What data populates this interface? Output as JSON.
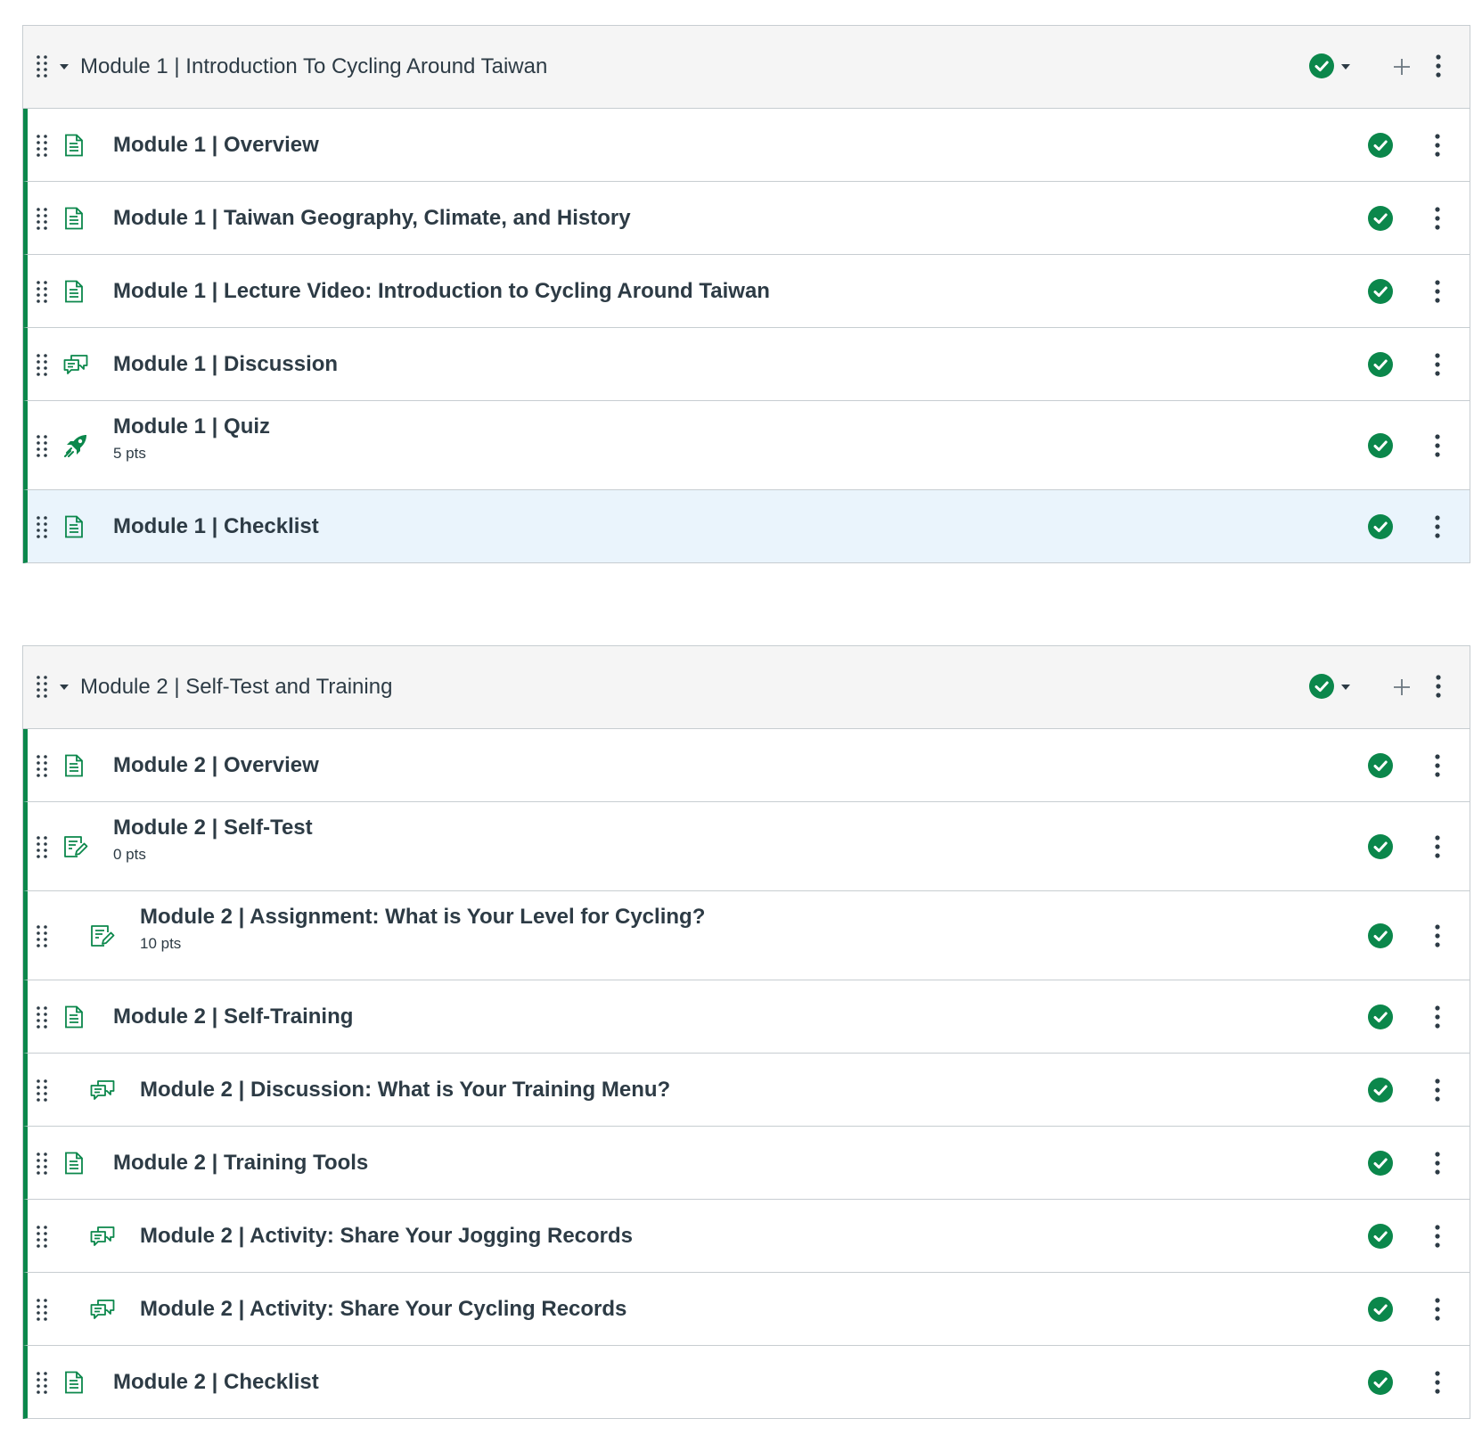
{
  "colors": {
    "accent_green": "#0b874b",
    "header_bg": "#f5f5f5",
    "text": "#2d3b45",
    "border": "#c7cdd1",
    "highlight_bg": "#eaf4fc"
  },
  "modules": [
    {
      "title": "Module 1 | Introduction To Cycling Around Taiwan",
      "published": true,
      "items": [
        {
          "title": "Module 1 | Overview",
          "icon": "page-icon",
          "indent": 0,
          "points": "",
          "published": true
        },
        {
          "title": "Module 1 | Taiwan Geography, Climate, and History",
          "icon": "page-icon",
          "indent": 0,
          "points": "",
          "published": true
        },
        {
          "title": "Module 1 | Lecture Video: Introduction to Cycling Around Taiwan",
          "icon": "page-icon",
          "indent": 0,
          "points": "",
          "published": true
        },
        {
          "title": "Module 1 | Discussion",
          "icon": "discussion-icon",
          "indent": 0,
          "points": "",
          "published": true
        },
        {
          "title": "Module 1 | Quiz",
          "icon": "quiz-rocket-icon",
          "indent": 0,
          "points": "5 pts",
          "published": true
        },
        {
          "title": "Module 1 | Checklist",
          "icon": "page-icon",
          "indent": 0,
          "points": "",
          "published": true,
          "highlighted": true
        }
      ]
    },
    {
      "title": "Module 2 | Self-Test and Training",
      "published": true,
      "items": [
        {
          "title": "Module 2 | Overview",
          "icon": "page-icon",
          "indent": 0,
          "points": "",
          "published": true
        },
        {
          "title": "Module 2 | Self-Test",
          "icon": "assignment-icon",
          "indent": 0,
          "points": "0 pts",
          "published": true
        },
        {
          "title": "Module 2 | Assignment: What is Your Level for Cycling?",
          "icon": "assignment-icon",
          "indent": 1,
          "points": "10 pts",
          "published": true
        },
        {
          "title": "Module 2 | Self-Training",
          "icon": "page-icon",
          "indent": 0,
          "points": "",
          "published": true
        },
        {
          "title": "Module 2 | Discussion: What is Your Training Menu?",
          "icon": "discussion-icon",
          "indent": 1,
          "points": "",
          "published": true
        },
        {
          "title": "Module 2 | Training Tools",
          "icon": "page-icon",
          "indent": 0,
          "points": "",
          "published": true
        },
        {
          "title": "Module 2 | Activity: Share Your Jogging Records",
          "icon": "discussion-icon",
          "indent": 1,
          "points": "",
          "published": true
        },
        {
          "title": "Module 2 | Activity: Share Your Cycling Records",
          "icon": "discussion-icon",
          "indent": 1,
          "points": "",
          "published": true
        },
        {
          "title": "Module 2 | Checklist",
          "icon": "page-icon",
          "indent": 0,
          "points": "",
          "published": true
        }
      ]
    }
  ]
}
